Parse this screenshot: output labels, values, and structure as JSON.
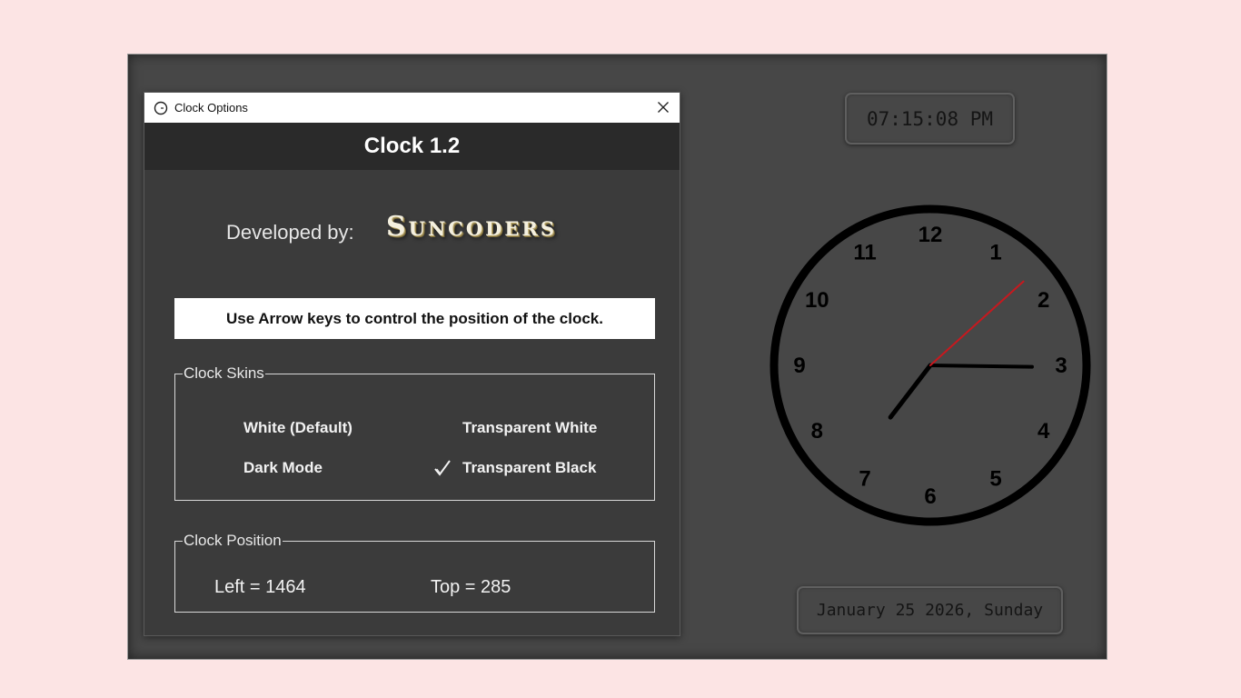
{
  "window": {
    "title": "Clock Options",
    "close_icon": "close-icon",
    "app_icon": "clock-icon"
  },
  "header": {
    "title": "Clock 1.2"
  },
  "developer": {
    "label": "Developed by:",
    "brand": "Suncoders"
  },
  "notice": {
    "text": "Use Arrow keys to control the position of the clock."
  },
  "skins": {
    "legend": "Clock Skins",
    "options": [
      {
        "label": "White (Default)",
        "selected": false
      },
      {
        "label": "Transparent White",
        "selected": false
      },
      {
        "label": "Dark Mode",
        "selected": false
      },
      {
        "label": "Transparent Black",
        "selected": true
      }
    ]
  },
  "position": {
    "legend": "Clock Position",
    "left": "Left = 1464",
    "top": "Top = 285"
  },
  "clock": {
    "digital_time": "07:15:08 PM",
    "date": "January 25 2026, Sunday",
    "numerals": [
      "12",
      "1",
      "2",
      "3",
      "4",
      "5",
      "6",
      "7",
      "8",
      "9",
      "10",
      "11"
    ],
    "hours": 7,
    "minutes": 15,
    "seconds": 8,
    "colors": {
      "hands": "#000000",
      "second_hand": "#c8181e",
      "ring": "#000000"
    }
  },
  "colors": {
    "page_background": "#fce4e4",
    "frame": "#474747",
    "dialog": "#3b3b3b",
    "header": "#2a2a2a"
  }
}
